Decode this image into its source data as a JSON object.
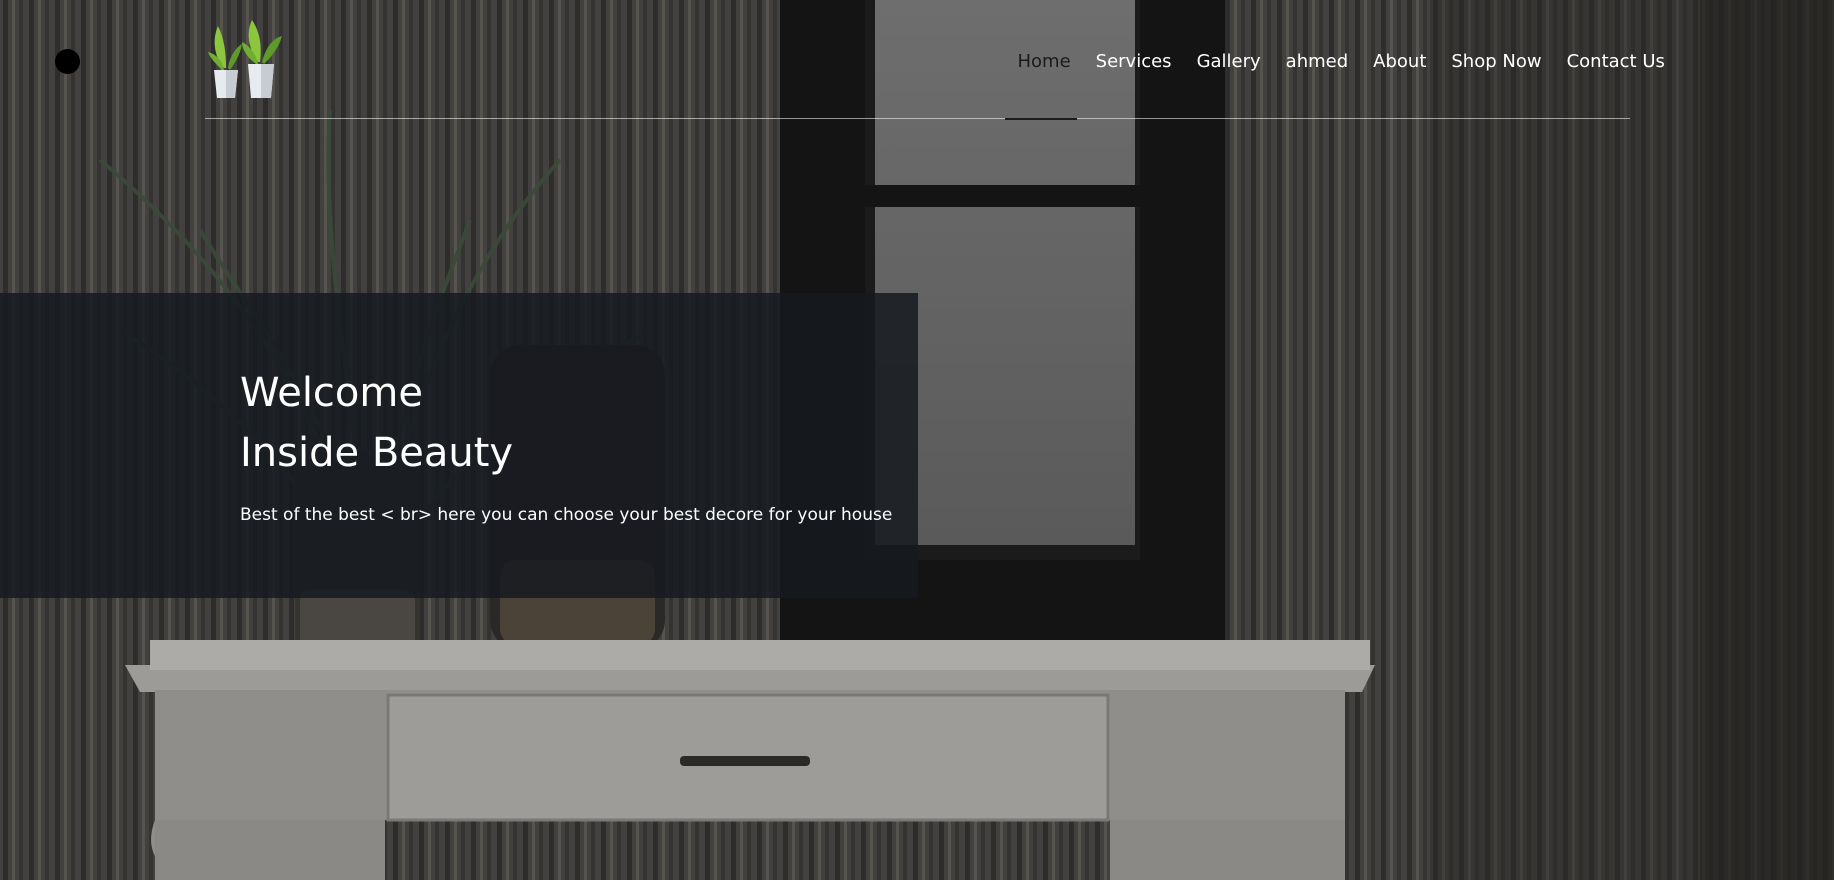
{
  "colors": {
    "hero_panel": "#161a1f",
    "nav_text": "#ffffff",
    "nav_active_text": "#1b1b1b"
  },
  "header": {
    "logo_icon": "potted-plants-logo",
    "nav": [
      {
        "label": "Home",
        "active": true
      },
      {
        "label": "Services",
        "active": false
      },
      {
        "label": "Gallery",
        "active": false
      },
      {
        "label": "ahmed",
        "active": false
      },
      {
        "label": "About",
        "active": false
      },
      {
        "label": "Shop Now",
        "active": false
      },
      {
        "label": "Contact Us",
        "active": false
      }
    ]
  },
  "hero": {
    "title_line1": "Welcome",
    "title_line2": "Inside Beauty",
    "subtitle": "Best of the best < br> here you can choose your best decore for your house"
  }
}
